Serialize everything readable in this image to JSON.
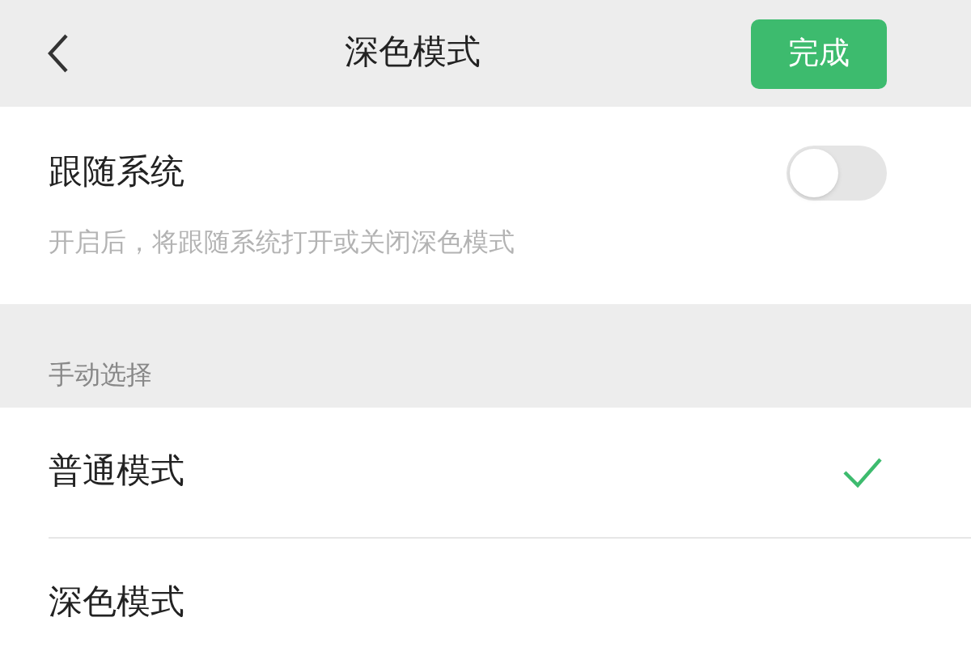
{
  "header": {
    "title": "深色模式",
    "done_button": "完成"
  },
  "follow_system": {
    "label": "跟随系统",
    "on": false,
    "description": "开启后，将跟随系统打开或关闭深色模式"
  },
  "manual": {
    "section_label": "手动选择",
    "options": [
      {
        "label": "普通模式",
        "selected": true
      },
      {
        "label": "深色模式",
        "selected": false
      }
    ]
  }
}
